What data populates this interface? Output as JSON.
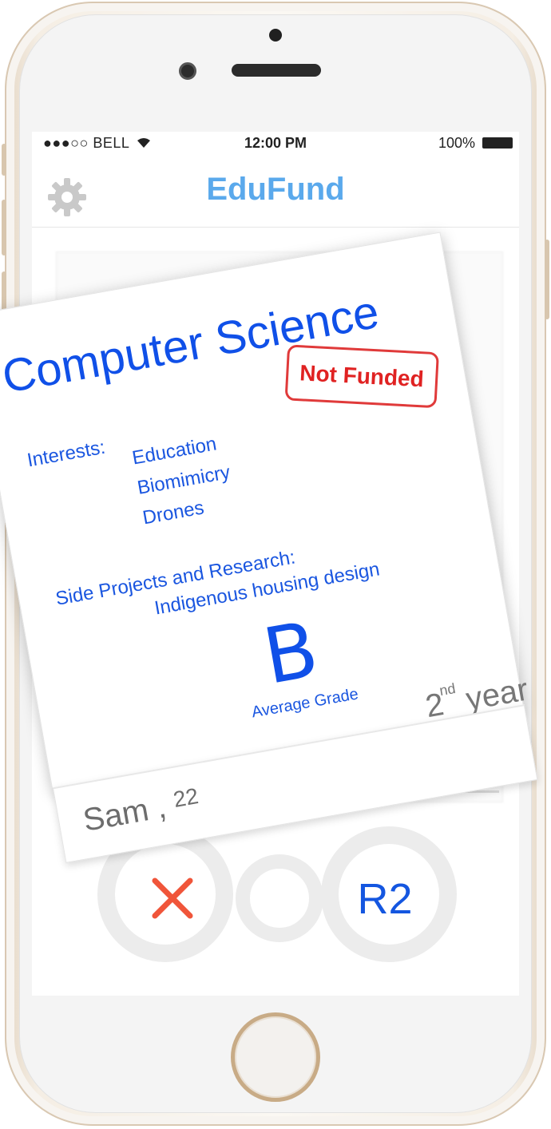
{
  "status_bar": {
    "carrier": "●●●○○ BELL",
    "wifi_icon": "wifi-icon",
    "time": "12:00 PM",
    "battery": "100%"
  },
  "nav": {
    "title": "EduFund",
    "settings_icon": "gear-icon"
  },
  "card": {
    "title": "Computer Science",
    "stamp": "Not Funded",
    "interests_label": "Interests:",
    "interests": [
      "Education",
      "Biomimicry",
      "Drones"
    ],
    "projects_label": "Side Projects and Research:",
    "project": "Indigenous housing design",
    "grade": "B",
    "grade_caption": "Average Grade",
    "year_num": "2",
    "year_suffix": "nd",
    "year_word": "year",
    "name": "Sam",
    "age": "22"
  },
  "actions": {
    "reject_icon": "close-icon",
    "right_label": "R2"
  },
  "colors": {
    "accent": "#5aa9ec",
    "card_text": "#1050e8",
    "stamp": "#e02222",
    "reject": "#f0553a"
  }
}
